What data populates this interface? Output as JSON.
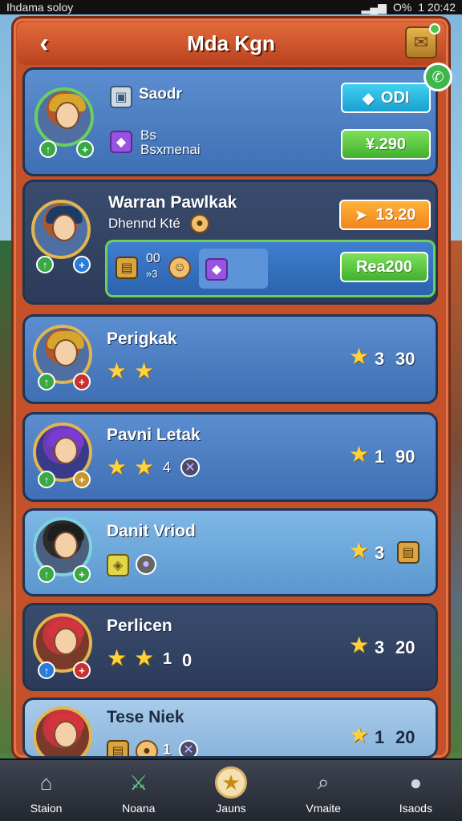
{
  "status_bar": {
    "carrier": "Ihdama soloy",
    "battery": "O%",
    "time": "1 20:42"
  },
  "header": {
    "title": "Mda Kgn"
  },
  "cards": [
    {
      "name": "Saodr",
      "sub1": "Bs",
      "sub2": "Bsxmenai",
      "button1": "ODI",
      "button2": "¥.290"
    },
    {
      "name": "Warran Pawlkak",
      "sub": "Dhennd Kté",
      "price": "13.20",
      "inner_count": "00",
      "inner_sub": "»3",
      "action": "Rea200"
    },
    {
      "name": "Perigkak",
      "rating_a": "3",
      "rating_b": "30"
    },
    {
      "name": "Pavni Letak",
      "rating_a": "1",
      "rating_b": "90",
      "inline": "4"
    },
    {
      "name": "Danit Vriod",
      "rating_a": "3"
    },
    {
      "name": "Perlicen",
      "rating_a": "3",
      "rating_b": "20",
      "inline": "1",
      "inline2": "0"
    },
    {
      "name": "Tese Niek",
      "rating_a": "1",
      "rating_b": "20",
      "inline": "1"
    }
  ],
  "nav": [
    {
      "label": "Staion",
      "icon": "home-icon"
    },
    {
      "label": "Noana",
      "icon": "sword-icon"
    },
    {
      "label": "Jauns",
      "icon": "star-icon",
      "active": true
    },
    {
      "label": "Vmaite",
      "icon": "search-icon"
    },
    {
      "label": "Isaods",
      "icon": "person-icon"
    }
  ]
}
